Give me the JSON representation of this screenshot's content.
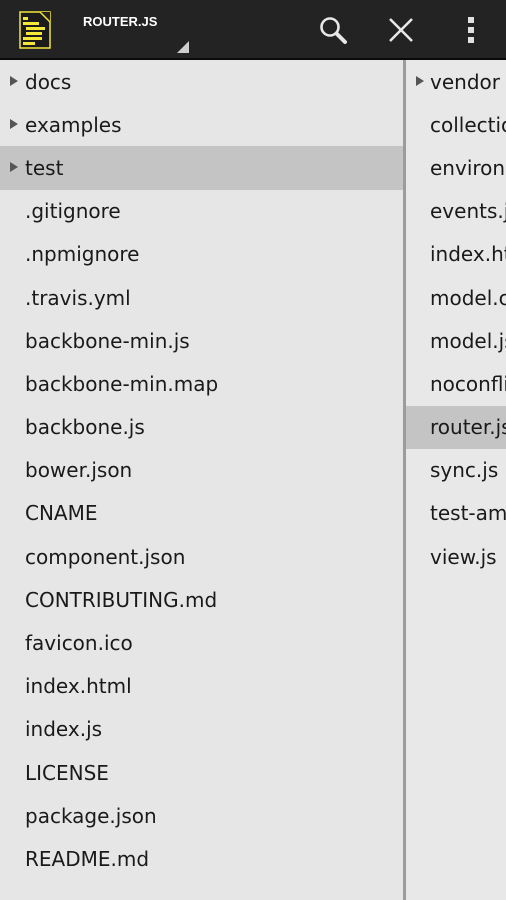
{
  "toolbar": {
    "title": "ROUTER.JS",
    "search_icon": "search-icon",
    "close_icon": "close-icon",
    "menu_icon": "overflow-menu-icon",
    "app_icon": "document-list-icon",
    "accent": "#f5e63a"
  },
  "left_pane": {
    "items": [
      {
        "label": "docs",
        "folder": true,
        "selected": false
      },
      {
        "label": "examples",
        "folder": true,
        "selected": false
      },
      {
        "label": "test",
        "folder": true,
        "selected": true
      },
      {
        "label": ".gitignore",
        "folder": false,
        "selected": false
      },
      {
        "label": ".npmignore",
        "folder": false,
        "selected": false
      },
      {
        "label": ".travis.yml",
        "folder": false,
        "selected": false
      },
      {
        "label": "backbone-min.js",
        "folder": false,
        "selected": false
      },
      {
        "label": "backbone-min.map",
        "folder": false,
        "selected": false
      },
      {
        "label": "backbone.js",
        "folder": false,
        "selected": false
      },
      {
        "label": "bower.json",
        "folder": false,
        "selected": false
      },
      {
        "label": "CNAME",
        "folder": false,
        "selected": false
      },
      {
        "label": "component.json",
        "folder": false,
        "selected": false
      },
      {
        "label": "CONTRIBUTING.md",
        "folder": false,
        "selected": false
      },
      {
        "label": "favicon.ico",
        "folder": false,
        "selected": false
      },
      {
        "label": "index.html",
        "folder": false,
        "selected": false
      },
      {
        "label": "index.js",
        "folder": false,
        "selected": false
      },
      {
        "label": "LICENSE",
        "folder": false,
        "selected": false
      },
      {
        "label": "package.json",
        "folder": false,
        "selected": false
      },
      {
        "label": "README.md",
        "folder": false,
        "selected": false
      }
    ]
  },
  "right_pane": {
    "items": [
      {
        "label": "vendor",
        "folder": true,
        "selected": false
      },
      {
        "label": "collection.js",
        "folder": false,
        "selected": false
      },
      {
        "label": "environment.js",
        "folder": false,
        "selected": false
      },
      {
        "label": "events.js",
        "folder": false,
        "selected": false
      },
      {
        "label": "index.html",
        "folder": false,
        "selected": false
      },
      {
        "label": "model.coffee",
        "folder": false,
        "selected": false
      },
      {
        "label": "model.js",
        "folder": false,
        "selected": false
      },
      {
        "label": "noconflict.js",
        "folder": false,
        "selected": false
      },
      {
        "label": "router.js",
        "folder": false,
        "selected": true
      },
      {
        "label": "sync.js",
        "folder": false,
        "selected": false
      },
      {
        "label": "test-amd.html",
        "folder": false,
        "selected": false
      },
      {
        "label": "view.js",
        "folder": false,
        "selected": false
      }
    ]
  }
}
